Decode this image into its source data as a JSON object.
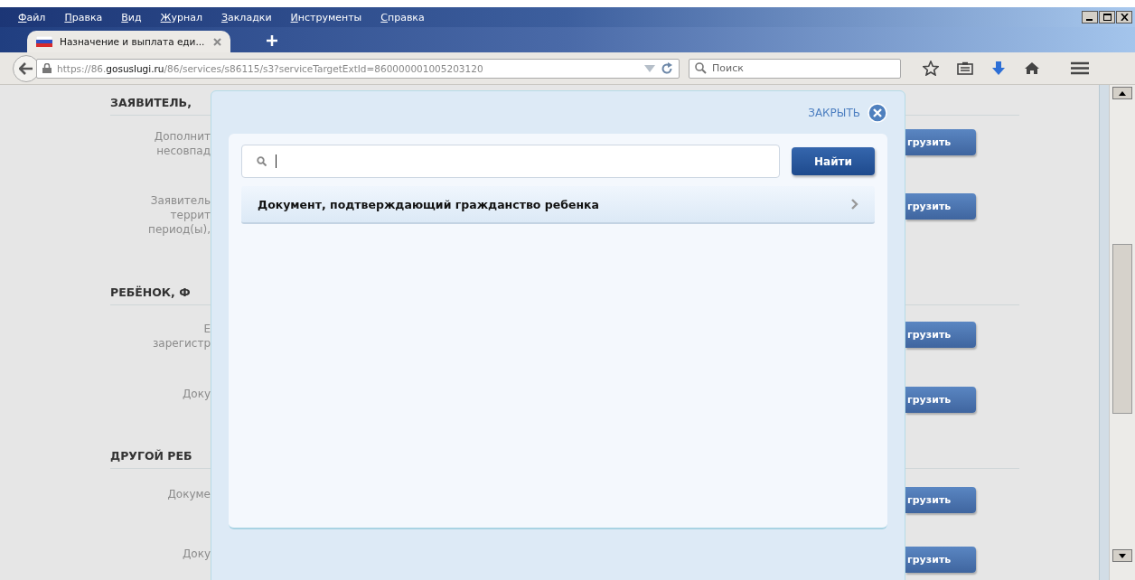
{
  "menu_bar": {
    "items": [
      "Файл",
      "Правка",
      "Вид",
      "Журнал",
      "Закладки",
      "Инструменты",
      "Справка"
    ]
  },
  "tabs": [
    {
      "title": "Назначение и выплата еди...",
      "selected": true
    }
  ],
  "nav_bar": {
    "url": "https://86.**gosuslugi.ru**/86/services/s86115/s3?serviceTargetExtId=860000001005203120",
    "search_placeholder": "Поиск"
  },
  "page": {
    "sections": [
      {
        "heading": "ЗАЯВИТЕЛЬ,",
        "items": [
          {
            "label_lines": [
              "Дополнит",
              "несовпад"
            ],
            "button": "грузить"
          },
          {
            "label_lines": [
              "Заявитель",
              "террит",
              "период(ы),"
            ],
            "button": "грузить"
          }
        ]
      },
      {
        "heading": "РЕБЁНОК, Ф",
        "items": [
          {
            "label_lines": [
              "Е",
              "зарегистр"
            ],
            "button": "грузить"
          },
          {
            "label_lines": [
              "Доку"
            ],
            "button": "грузить"
          }
        ]
      },
      {
        "heading": "ДРУГОЙ РЕБ",
        "items": [
          {
            "label_lines": [
              "Докуме"
            ],
            "button": "грузить"
          },
          {
            "label_lines": [
              "Доку"
            ],
            "button": "грузить"
          }
        ]
      }
    ]
  },
  "dialog": {
    "close_label": "ЗАКРЫТЬ",
    "find_button": "Найти",
    "results": [
      {
        "title": "Документ, подтверждающий гражданство ребенка"
      }
    ]
  }
}
